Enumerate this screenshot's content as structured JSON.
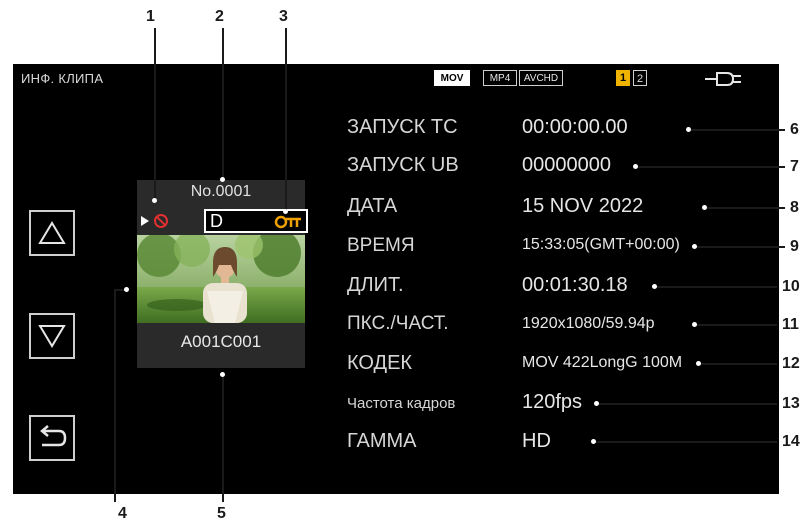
{
  "screen": {
    "title": "ИНФ. КЛИПА",
    "formats": [
      {
        "label": "MOV",
        "active": true
      },
      {
        "label": "MP4",
        "active": false
      },
      {
        "label": "AVCHD",
        "active": false
      }
    ],
    "slots": [
      {
        "label": "1",
        "active": true
      },
      {
        "label": "2",
        "active": false
      }
    ],
    "power_icon": "ac-power-plug-icon"
  },
  "nav": {
    "up_icon": "triangle-up-icon",
    "down_icon": "triangle-down-icon",
    "return_icon": "return-arrow-icon"
  },
  "clip": {
    "number": "No.0001",
    "name": "A001C001",
    "status_letter": "D",
    "icons": [
      "play-marker-icon",
      "prohibited-icon",
      "protect-key-icon"
    ]
  },
  "info_rows": [
    {
      "label": "ЗАПУСК ТС",
      "value": "00:00:00.00",
      "callout": "6"
    },
    {
      "label": "ЗАПУСК UB",
      "value": "00000000",
      "callout": "7"
    },
    {
      "label": "ДАТА",
      "value": "15 NOV 2022",
      "callout": "8"
    },
    {
      "label": "ВРЕМЯ",
      "value": "15:33:05(GMT+00:00)",
      "callout": "9"
    },
    {
      "label": "ДЛИТ.",
      "value": "00:01:30.18",
      "callout": "10"
    },
    {
      "label": "ПКС./ЧАСТ.",
      "value": "1920x1080/59.94p",
      "callout": "11"
    },
    {
      "label": "КОДЕК",
      "value": "MOV 422LongG 100M",
      "callout": "12"
    },
    {
      "label": "Частота кадров",
      "value": "120fps",
      "callout": "13"
    },
    {
      "label": "ГАММА",
      "value": "HD",
      "callout": "14"
    }
  ],
  "callouts_top": [
    "1",
    "2",
    "3"
  ],
  "callouts_bottom": [
    "4",
    "5"
  ],
  "colors": {
    "screen_bg": "#000000",
    "accent_orange": "#f0a000",
    "prohibited_red": "#e03030",
    "slot_active": "#f0b400"
  }
}
